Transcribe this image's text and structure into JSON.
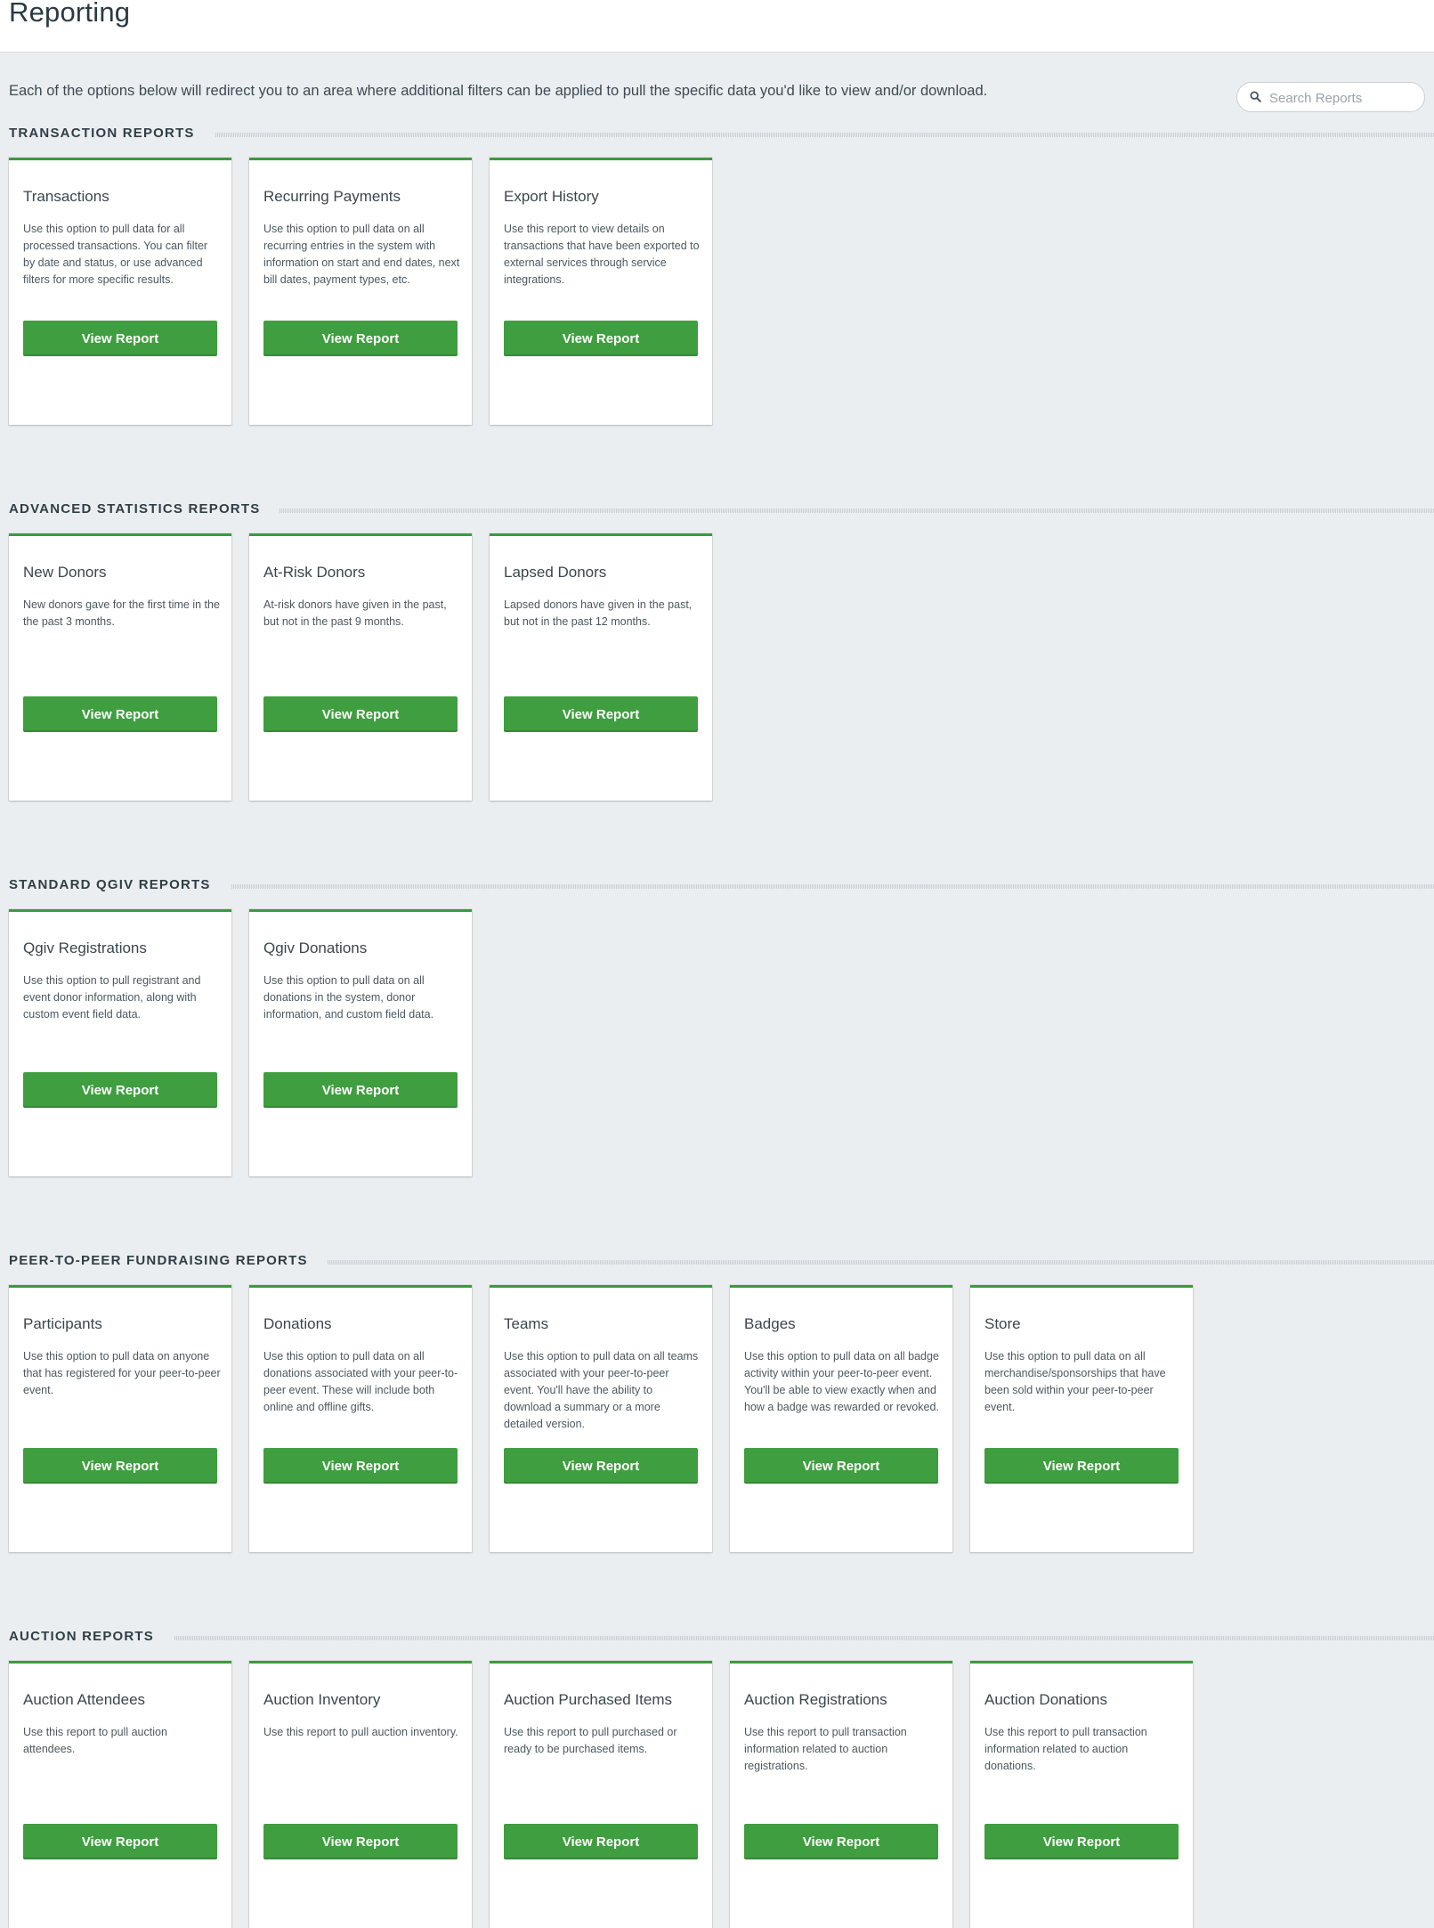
{
  "header": {
    "title": "Reporting"
  },
  "intro": "Each of the options below will redirect you to an area where additional filters can be applied to pull the specific data you'd like to view and/or download.",
  "search": {
    "placeholder": "Search Reports",
    "value": ""
  },
  "colors": {
    "accent": "#3f9e3f",
    "card_border_top": "#3b9a3f",
    "background": "#ebeef0"
  },
  "sections": [
    {
      "title": "TRANSACTION REPORTS",
      "cards": [
        {
          "title": "Transactions",
          "description": "Use this option to pull data for all processed transactions. You can filter by date and status, or use advanced filters for more specific results.",
          "button": "View Report"
        },
        {
          "title": "Recurring Payments",
          "description": "Use this option to pull data on all recurring entries in the system with information on start and end dates, next bill dates, payment types, etc.",
          "button": "View Report"
        },
        {
          "title": "Export History",
          "description": "Use this report to view details on transactions that have been exported to external services through service integrations.",
          "button": "View Report"
        }
      ]
    },
    {
      "title": "ADVANCED STATISTICS REPORTS",
      "cards": [
        {
          "title": "New Donors",
          "description": "New donors gave for the first time in the the past 3 months.",
          "button": "View Report"
        },
        {
          "title": "At-Risk Donors",
          "description": "At-risk donors have given in the past, but not in the past 9 months.",
          "button": "View Report"
        },
        {
          "title": "Lapsed Donors",
          "description": "Lapsed donors have given in the past, but not in the past 12 months.",
          "button": "View Report"
        }
      ]
    },
    {
      "title": "STANDARD QGIV REPORTS",
      "cards": [
        {
          "title": "Qgiv Registrations",
          "description": "Use this option to pull registrant and event donor information, along with custom event field data.",
          "button": "View Report"
        },
        {
          "title": "Qgiv Donations",
          "description": "Use this option to pull data on all donations in the system, donor information, and custom field data.",
          "button": "View Report"
        }
      ]
    },
    {
      "title": "PEER-TO-PEER FUNDRAISING REPORTS",
      "cards": [
        {
          "title": "Participants",
          "description": "Use this option to pull data on anyone that has registered for your peer-to-peer event.",
          "button": "View Report"
        },
        {
          "title": "Donations",
          "description": "Use this option to pull data on all donations associated with your peer-to-peer event. These will include both online and offline gifts.",
          "button": "View Report"
        },
        {
          "title": "Teams",
          "description": "Use this option to pull data on all teams associated with your peer-to-peer event. You'll have the ability to download a summary or a more detailed version.",
          "button": "View Report"
        },
        {
          "title": "Badges",
          "description": "Use this option to pull data on all badge activity within your peer-to-peer event. You'll be able to view exactly when and how a badge was rewarded or revoked.",
          "button": "View Report"
        },
        {
          "title": "Store",
          "description": "Use this option to pull data on all merchandise/sponsorships that have been sold within your peer-to-peer event.",
          "button": "View Report"
        }
      ]
    },
    {
      "title": "AUCTION REPORTS",
      "cards": [
        {
          "title": "Auction Attendees",
          "description": "Use this report to pull auction attendees.",
          "button": "View Report"
        },
        {
          "title": "Auction Inventory",
          "description": "Use this report to pull auction inventory.",
          "button": "View Report"
        },
        {
          "title": "Auction Purchased Items",
          "description": "Use this report to pull purchased or ready to be purchased items.",
          "button": "View Report"
        },
        {
          "title": "Auction Registrations",
          "description": "Use this report to pull transaction information related to auction registrations.",
          "button": "View Report"
        },
        {
          "title": "Auction Donations",
          "description": "Use this report to pull transaction information related to auction donations.",
          "button": "View Report"
        }
      ]
    }
  ]
}
